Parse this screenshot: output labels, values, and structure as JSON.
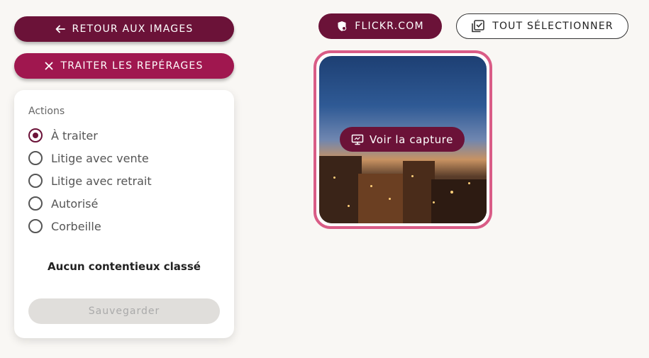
{
  "nav": {
    "back_label": "RETOUR AUX IMAGES",
    "process_label": "TRAITER LES REPÉRAGES"
  },
  "actions": {
    "title": "Actions",
    "options": [
      {
        "label": "À traiter",
        "checked": true
      },
      {
        "label": "Litige avec vente",
        "checked": false
      },
      {
        "label": "Litige avec retrait",
        "checked": false
      },
      {
        "label": "Autorisé",
        "checked": false
      },
      {
        "label": "Corbeille",
        "checked": false
      }
    ],
    "empty_message": "Aucun contentieux classé",
    "save_label": "Sauvegarder"
  },
  "toolbar": {
    "source_label": "FLICKR.COM",
    "select_all_label": "TOUT SÉLECTIONNER"
  },
  "card": {
    "capture_label": "Voir la capture",
    "selected": true
  },
  "colors": {
    "primary": "#6b1238",
    "accent": "#a0174f",
    "card_border": "#d95c86",
    "background": "#f9f7f4"
  }
}
